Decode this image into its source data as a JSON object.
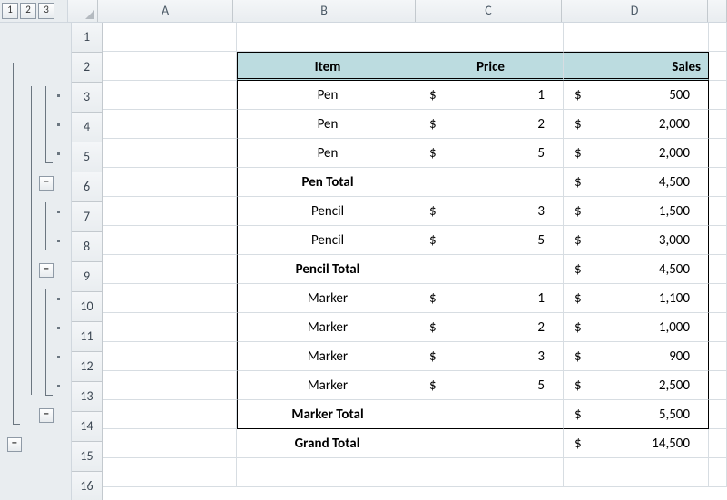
{
  "outline": {
    "levels": [
      "1",
      "2",
      "3"
    ],
    "collapse_symbol": "−"
  },
  "columns": [
    "A",
    "B",
    "C",
    "D"
  ],
  "row_numbers": [
    "1",
    "2",
    "3",
    "4",
    "5",
    "6",
    "7",
    "8",
    "9",
    "10",
    "11",
    "12",
    "13",
    "14",
    "15",
    "16"
  ],
  "headers": {
    "item": "Item",
    "price": "Price",
    "sales": "Sales"
  },
  "rows": [
    {
      "item": "Pen",
      "price": {
        "sym": "$",
        "val": "1"
      },
      "sales": {
        "sym": "$",
        "val": "500"
      }
    },
    {
      "item": "Pen",
      "price": {
        "sym": "$",
        "val": "2"
      },
      "sales": {
        "sym": "$",
        "val": "2,000"
      }
    },
    {
      "item": "Pen",
      "price": {
        "sym": "$",
        "val": "5"
      },
      "sales": {
        "sym": "$",
        "val": "2,000"
      }
    },
    {
      "item": "Pen Total",
      "subtotal": true,
      "sales": {
        "sym": "$",
        "val": "4,500"
      }
    },
    {
      "item": "Pencil",
      "price": {
        "sym": "$",
        "val": "3"
      },
      "sales": {
        "sym": "$",
        "val": "1,500"
      }
    },
    {
      "item": "Pencil",
      "price": {
        "sym": "$",
        "val": "5"
      },
      "sales": {
        "sym": "$",
        "val": "3,000"
      }
    },
    {
      "item": "Pencil Total",
      "subtotal": true,
      "sales": {
        "sym": "$",
        "val": "4,500"
      }
    },
    {
      "item": "Marker",
      "price": {
        "sym": "$",
        "val": "1"
      },
      "sales": {
        "sym": "$",
        "val": "1,100"
      }
    },
    {
      "item": "Marker",
      "price": {
        "sym": "$",
        "val": "2"
      },
      "sales": {
        "sym": "$",
        "val": "1,000"
      }
    },
    {
      "item": "Marker",
      "price": {
        "sym": "$",
        "val": "3"
      },
      "sales": {
        "sym": "$",
        "val": "900"
      }
    },
    {
      "item": "Marker",
      "price": {
        "sym": "$",
        "val": "5"
      },
      "sales": {
        "sym": "$",
        "val": "2,500"
      }
    },
    {
      "item": "Marker Total",
      "subtotal": true,
      "sales": {
        "sym": "$",
        "val": "5,500"
      }
    },
    {
      "item": "Grand Total",
      "subtotal": true,
      "sales": {
        "sym": "$",
        "val": "14,500"
      }
    }
  ]
}
